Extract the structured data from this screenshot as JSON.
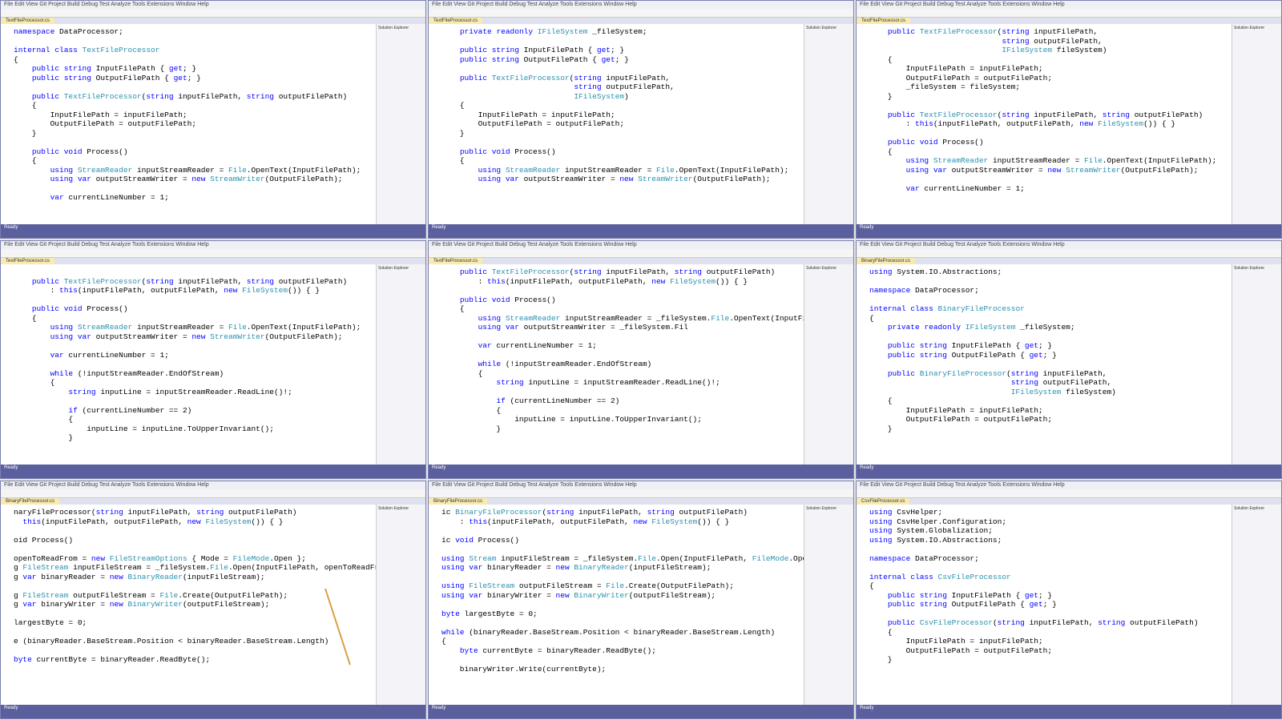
{
  "menu": "File  Edit  View  Git  Project  Build  Debug  Test  Analyze  Tools  Extensions  Window  Help",
  "panes": [
    {
      "tab": "TextFileProcessor.cs",
      "lines": [
        "namespace DataProcessor;",
        "",
        "internal class TextFileProcessor",
        "{",
        "    public string InputFilePath { get; }",
        "    public string OutputFilePath { get; }",
        "",
        "    public TextFileProcessor(string inputFilePath, string outputFilePath)",
        "    {",
        "        InputFilePath = inputFilePath;",
        "        OutputFilePath = outputFilePath;",
        "    }",
        "",
        "    public void Process()",
        "    {",
        "        using StreamReader inputStreamReader = File.OpenText(InputFilePath);",
        "        using var outputStreamWriter = new StreamWriter(OutputFilePath);",
        "",
        "        var currentLineNumber = 1;"
      ]
    },
    {
      "tab": "TextFileProcessor.cs",
      "lines": [
        "    private readonly IFileSystem _fileSystem;",
        "",
        "    public string InputFilePath { get; }",
        "    public string OutputFilePath { get; }",
        "",
        "    public TextFileProcessor(string inputFilePath,",
        "                             string outputFilePath,",
        "                             IFileSystem)",
        "    {",
        "        InputFilePath = inputFilePath;",
        "        OutputFilePath = outputFilePath;",
        "    }",
        "",
        "    public void Process()",
        "    {",
        "        using StreamReader inputStreamReader = File.OpenText(InputFilePath);",
        "        using var outputStreamWriter = new StreamWriter(OutputFilePath);"
      ]
    },
    {
      "tab": "TextFileProcessor.cs",
      "lines": [
        "    public TextFileProcessor(string inputFilePath,",
        "                             string outputFilePath,",
        "                             IFileSystem fileSystem)",
        "    {",
        "        InputFilePath = inputFilePath;",
        "        OutputFilePath = outputFilePath;",
        "        _fileSystem = fileSystem;",
        "    }",
        "",
        "    public TextFileProcessor(string inputFilePath, string outputFilePath)",
        "        : this(inputFilePath, outputFilePath, new FileSystem()) { }",
        "",
        "    public void Process()",
        "    {",
        "        using StreamReader inputStreamReader = File.OpenText(InputFilePath);",
        "        using var outputStreamWriter = new StreamWriter(OutputFilePath);",
        "",
        "        var currentLineNumber = 1;"
      ]
    },
    {
      "tab": "TextFileProcessor.cs",
      "lines": [
        "",
        "    public TextFileProcessor(string inputFilePath, string outputFilePath)",
        "        : this(inputFilePath, outputFilePath, new FileSystem()) { }",
        "",
        "    public void Process()",
        "    {",
        "        using StreamReader inputStreamReader = File.OpenText(InputFilePath);",
        "        using var outputStreamWriter = new StreamWriter(OutputFilePath);",
        "",
        "        var currentLineNumber = 1;",
        "",
        "        while (!inputStreamReader.EndOfStream)",
        "        {",
        "            string inputLine = inputStreamReader.ReadLine()!;",
        "",
        "            if (currentLineNumber == 2)",
        "            {",
        "                inputLine = inputLine.ToUpperInvariant();",
        "            }"
      ]
    },
    {
      "tab": "TextFileProcessor.cs",
      "lines": [
        "    public TextFileProcessor(string inputFilePath, string outputFilePath)",
        "        : this(inputFilePath, outputFilePath, new FileSystem()) { }",
        "",
        "    public void Process()",
        "    {",
        "        using StreamReader inputStreamReader = _fileSystem.File.OpenText(InputFileP",
        "        using var outputStreamWriter = _fileSystem.Fil",
        "",
        "        var currentLineNumber = 1;",
        "",
        "        while (!inputStreamReader.EndOfStream)",
        "        {",
        "            string inputLine = inputStreamReader.ReadLine()!;",
        "",
        "            if (currentLineNumber == 2)",
        "            {",
        "                inputLine = inputLine.ToUpperInvariant();",
        "            }"
      ]
    },
    {
      "tab": "BinaryFileProcessor.cs",
      "lines": [
        "using System.IO.Abstractions;",
        "",
        "namespace DataProcessor;",
        "",
        "internal class BinaryFileProcessor",
        "{",
        "    private readonly IFileSystem _fileSystem;",
        "",
        "    public string InputFilePath { get; }",
        "    public string OutputFilePath { get; }",
        "",
        "    public BinaryFileProcessor(string inputFilePath,",
        "                               string outputFilePath,",
        "                               IFileSystem fileSystem)",
        "    {",
        "        InputFilePath = inputFilePath;",
        "        OutputFilePath = outputFilePath;",
        "    }"
      ]
    },
    {
      "tab": "BinaryFileProcessor.cs",
      "lines": [
        "naryFileProcessor(string inputFilePath, string outputFilePath)",
        "  this(inputFilePath, outputFilePath, new FileSystem()) { }",
        "",
        "oid Process()",
        "",
        "openToReadFrom = new FileStreamOptions { Mode = FileMode.Open };",
        "g FileStream inputFileStream = _fileSystem.File.Open(InputFilePath, openToReadFrom);",
        "g var binaryReader = new BinaryReader(inputFileStream);",
        "",
        "g FileStream outputFileStream = File.Create(OutputFilePath);",
        "g var binaryWriter = new BinaryWriter(outputFileStream);",
        "",
        "largestByte = 0;",
        "",
        "e (binaryReader.BaseStream.Position < binaryReader.BaseStream.Length)",
        "",
        "byte currentByte = binaryReader.ReadByte();"
      ]
    },
    {
      "tab": "BinaryFileProcessor.cs",
      "lines": [
        "ic BinaryFileProcessor(string inputFilePath, string outputFilePath)",
        "    : this(inputFilePath, outputFilePath, new FileSystem()) { }",
        "",
        "ic void Process()",
        "",
        "using Stream inputFileStream = _fileSystem.File.Open(InputFilePath, FileMode.Open);",
        "using var binaryReader = new BinaryReader(inputFileStream);",
        "",
        "using FileStream outputFileStream = File.Create(OutputFilePath);",
        "using var binaryWriter = new BinaryWriter(outputFileStream);",
        "",
        "byte largestByte = 0;",
        "",
        "while (binaryReader.BaseStream.Position < binaryReader.BaseStream.Length)",
        "{",
        "    byte currentByte = binaryReader.ReadByte();",
        "",
        "    binaryWriter.Write(currentByte);"
      ]
    },
    {
      "tab": "CsvFileProcessor.cs",
      "lines": [
        "using CsvHelper;",
        "using CsvHelper.Configuration;",
        "using System.Globalization;",
        "using System.IO.Abstractions;",
        "",
        "namespace DataProcessor;",
        "",
        "internal class CsvFileProcessor",
        "{",
        "    public string InputFilePath { get; }",
        "    public string OutputFilePath { get; }",
        "",
        "    public CsvFileProcessor(string inputFilePath, string outputFilePath)",
        "    {",
        "        InputFilePath = inputFilePath;",
        "        OutputFilePath = outputFilePath;",
        "    }"
      ]
    }
  ],
  "solution_title": "Solution Explorer",
  "status_text": "Ready"
}
